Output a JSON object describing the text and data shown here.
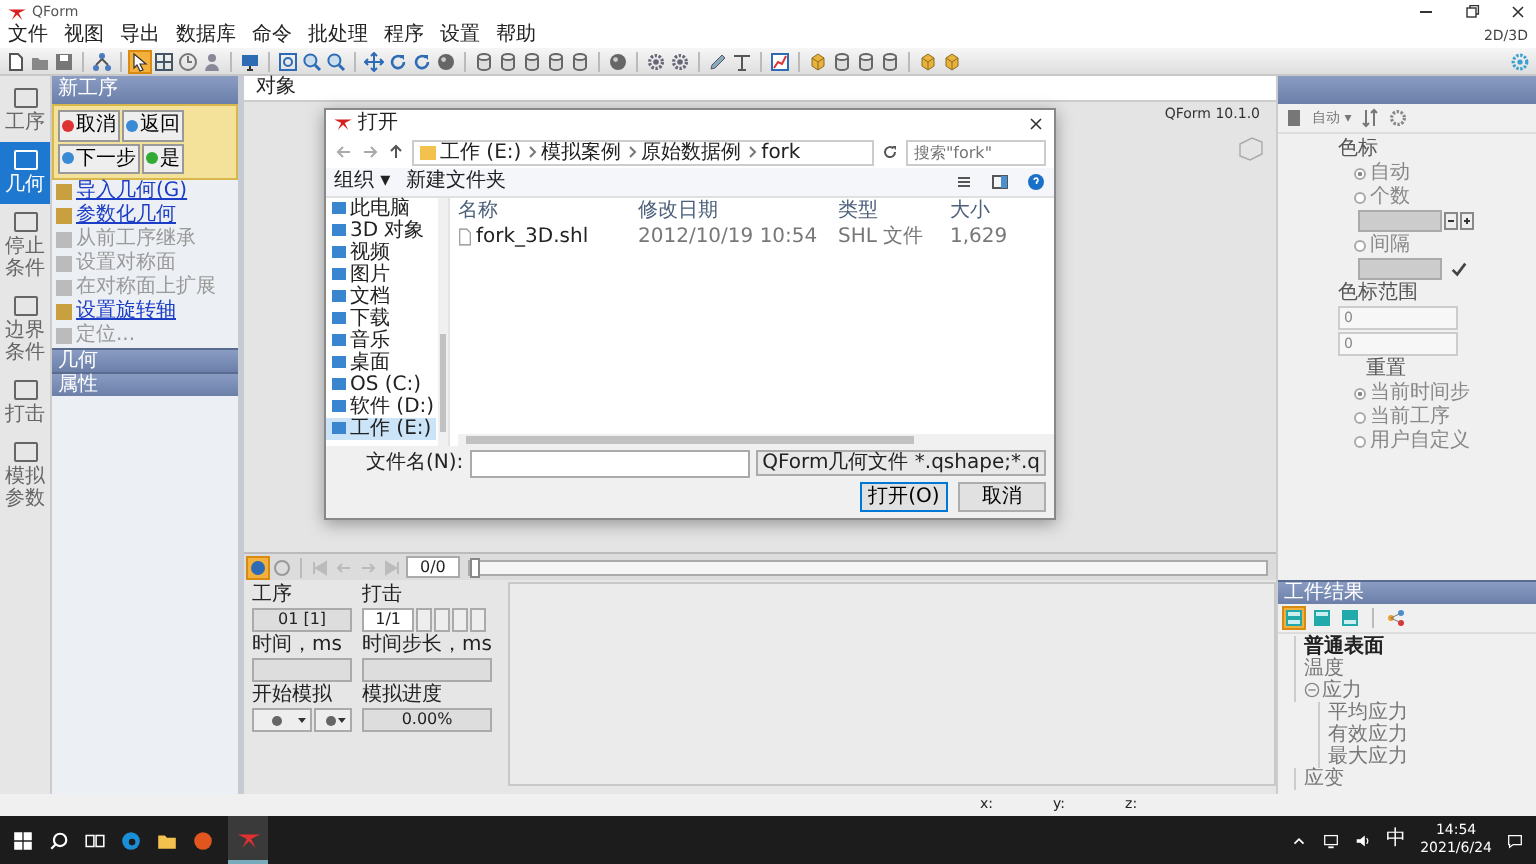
{
  "window": {
    "title": "QForm",
    "mode_label": "2D/3D"
  },
  "menu": [
    "文件",
    "视图",
    "导出",
    "数据库",
    "命令",
    "批处理",
    "程序",
    "设置",
    "帮助"
  ],
  "sidebar": [
    {
      "label": "工序",
      "selected": false
    },
    {
      "label": "几何",
      "selected": true
    },
    {
      "label": "停止条件",
      "selected": false
    },
    {
      "label": "边界条件",
      "selected": false
    },
    {
      "label": "打击",
      "selected": false
    },
    {
      "label": "模拟参数",
      "selected": false
    }
  ],
  "operation_panel": {
    "title": "新工序",
    "buttons": [
      {
        "label": "取消",
        "kind": "cancel"
      },
      {
        "label": "返回",
        "kind": "back"
      },
      {
        "label": "下一步",
        "kind": "next"
      },
      {
        "label": "是",
        "kind": "ok"
      }
    ],
    "actions": [
      {
        "label": "导入几何(G)",
        "disabled": false
      },
      {
        "label": "参数化几何",
        "disabled": false
      },
      {
        "label": "从前工序继承",
        "disabled": true
      },
      {
        "label": "设置对称面",
        "disabled": true
      },
      {
        "label": "在对称面上扩展",
        "disabled": true
      },
      {
        "label": "设置旋转轴",
        "disabled": false
      },
      {
        "label": "定位...",
        "disabled": true
      }
    ],
    "sections": [
      "几何",
      "属性"
    ]
  },
  "viewport": {
    "tab": "对象",
    "version": "QForm 10.1.0"
  },
  "dialog": {
    "title": "打开",
    "path": [
      "工作 (E:)",
      "模拟案例",
      "原始数据例",
      "fork"
    ],
    "search_placeholder": "搜索\"fork\"",
    "organize": "组织 ▾",
    "new_folder": "新建文件夹",
    "places": [
      {
        "label": "此电脑",
        "selected": false
      },
      {
        "label": "3D 对象",
        "selected": false
      },
      {
        "label": "视频",
        "selected": false
      },
      {
        "label": "图片",
        "selected": false
      },
      {
        "label": "文档",
        "selected": false
      },
      {
        "label": "下载",
        "selected": false
      },
      {
        "label": "音乐",
        "selected": false
      },
      {
        "label": "桌面",
        "selected": false
      },
      {
        "label": "OS (C:)",
        "selected": false
      },
      {
        "label": "软件 (D:)",
        "selected": false
      },
      {
        "label": "工作 (E:)",
        "selected": true
      }
    ],
    "columns": [
      "名称",
      "修改日期",
      "类型",
      "大小"
    ],
    "files": [
      {
        "name": "fork_3D.shl",
        "modified": "2012/10/19 10:54",
        "type": "SHL 文件",
        "size": "1,629"
      }
    ],
    "filename_label": "文件名(N):",
    "filter": "QForm几何文件 *.qshape;*.q",
    "open_button": "打开(O)",
    "cancel_button": "取消"
  },
  "player": {
    "counter": "0/0",
    "level": 0,
    "operation_label": "工序",
    "operation_value": "01 [1]",
    "blow_label": "打击",
    "blow_value": "1/1",
    "time_label": "时间，ms",
    "step_label": "时间步长，ms",
    "start_label": "开始模拟",
    "progress_label": "模拟进度",
    "progress_value": "0.00%"
  },
  "right_panel": {
    "mode": "自动 ▾",
    "scale_label": "色标",
    "scale_options": [
      {
        "label": "自动",
        "selected": true
      },
      {
        "label": "个数",
        "selected": false
      },
      {
        "label": "间隔",
        "selected": false
      }
    ],
    "range_label": "色标范围",
    "range_min": "0",
    "range_max": "0",
    "reset": "重置",
    "range_options": [
      {
        "label": "当前时间步",
        "selected": true
      },
      {
        "label": "当前工序",
        "selected": false
      },
      {
        "label": "用户自定义",
        "selected": false
      }
    ],
    "results_title": "工件结果",
    "results": [
      {
        "label": "普通表面",
        "selected": true
      },
      {
        "label": "温度",
        "selected": false
      },
      {
        "label": "应力",
        "selected": false,
        "expanded": true,
        "children": [
          {
            "label": "平均应力",
            "selected": false
          },
          {
            "label": "有效应力",
            "selected": false
          },
          {
            "label": "最大应力",
            "selected": false
          }
        ]
      },
      {
        "label": "应变",
        "selected": false
      }
    ]
  },
  "status_bar": {
    "coords": [
      "x:",
      "y:",
      "z:"
    ]
  },
  "taskbar": {
    "ime": "中",
    "time": "14:54",
    "date": "2021/6/24"
  }
}
